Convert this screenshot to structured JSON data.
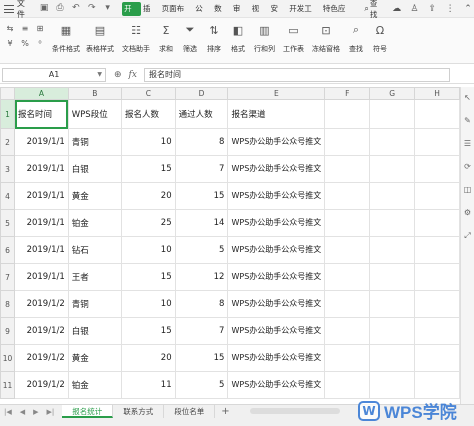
{
  "menubar": {
    "file_label": "文件",
    "tabs": [
      {
        "label": "开始",
        "active": true
      },
      {
        "label": "插入",
        "active": false
      },
      {
        "label": "页面布局",
        "active": false
      },
      {
        "label": "公式",
        "active": false
      },
      {
        "label": "数据",
        "active": false
      },
      {
        "label": "审阅",
        "active": false
      },
      {
        "label": "视图",
        "active": false
      },
      {
        "label": "安全",
        "active": false
      },
      {
        "label": "开发工具",
        "active": false
      },
      {
        "label": "特色应用",
        "active": false
      }
    ],
    "search_label": "查找",
    "accent_color": "#2a9d4a"
  },
  "ribbon": {
    "buttons": [
      {
        "label": "条件格式",
        "icon": "conditional-format-icon"
      },
      {
        "label": "表格样式",
        "icon": "table-style-icon"
      },
      {
        "label": "文档助手",
        "icon": "doc-assistant-icon"
      },
      {
        "label": "求和",
        "icon": "sum-icon"
      },
      {
        "label": "筛选",
        "icon": "filter-icon"
      },
      {
        "label": "排序",
        "icon": "sort-icon"
      },
      {
        "label": "格式",
        "icon": "format-icon"
      },
      {
        "label": "行和列",
        "icon": "rows-cols-icon"
      },
      {
        "label": "工作表",
        "icon": "worksheet-icon"
      },
      {
        "label": "冻结窗格",
        "icon": "freeze-pane-icon"
      },
      {
        "label": "查找",
        "icon": "find-icon"
      },
      {
        "label": "符号",
        "icon": "symbol-icon"
      }
    ]
  },
  "formulabar": {
    "cell_ref": "A1",
    "fx_label": "fx",
    "content": "报名时间"
  },
  "sheet": {
    "columns": [
      "A",
      "B",
      "C",
      "D",
      "E",
      "F",
      "G",
      "H"
    ],
    "selected_column": "A",
    "header_row": [
      "报名时间",
      "WPS段位",
      "报名人数",
      "通过人数",
      "报名渠道",
      "",
      "",
      ""
    ],
    "rows": [
      {
        "num": "2",
        "date": "2019/1/1",
        "level": "青铜",
        "signup": "10",
        "passed": "8",
        "channel": "WPS办公助手公众号推文"
      },
      {
        "num": "3",
        "date": "2019/1/1",
        "level": "白银",
        "signup": "15",
        "passed": "7",
        "channel": "WPS办公助手公众号推文"
      },
      {
        "num": "4",
        "date": "2019/1/1",
        "level": "黄金",
        "signup": "20",
        "passed": "15",
        "channel": "WPS办公助手公众号推文"
      },
      {
        "num": "5",
        "date": "2019/1/1",
        "level": "铂金",
        "signup": "25",
        "passed": "14",
        "channel": "WPS办公助手公众号推文"
      },
      {
        "num": "6",
        "date": "2019/1/1",
        "level": "钻石",
        "signup": "10",
        "passed": "5",
        "channel": "WPS办公助手公众号推文"
      },
      {
        "num": "7",
        "date": "2019/1/1",
        "level": "王者",
        "signup": "15",
        "passed": "12",
        "channel": "WPS办公助手公众号推文"
      },
      {
        "num": "8",
        "date": "2019/1/2",
        "level": "青铜",
        "signup": "10",
        "passed": "8",
        "channel": "WPS办公助手公众号推文"
      },
      {
        "num": "9",
        "date": "2019/1/2",
        "level": "白银",
        "signup": "15",
        "passed": "7",
        "channel": "WPS办公助手公众号推文"
      },
      {
        "num": "10",
        "date": "2019/1/2",
        "level": "黄金",
        "signup": "20",
        "passed": "15",
        "channel": "WPS办公助手公众号推文"
      },
      {
        "num": "11",
        "date": "2019/1/2",
        "level": "铂金",
        "signup": "11",
        "passed": "5",
        "channel": "WPS办公助手公众号推文"
      }
    ]
  },
  "sheet_tabs": [
    {
      "label": "报名统计",
      "active": true
    },
    {
      "label": "联系方式",
      "active": false
    },
    {
      "label": "段位名单",
      "active": false
    }
  ],
  "add_sheet_label": "+",
  "watermark": {
    "logo_char": "W",
    "text": "WPS学院"
  }
}
